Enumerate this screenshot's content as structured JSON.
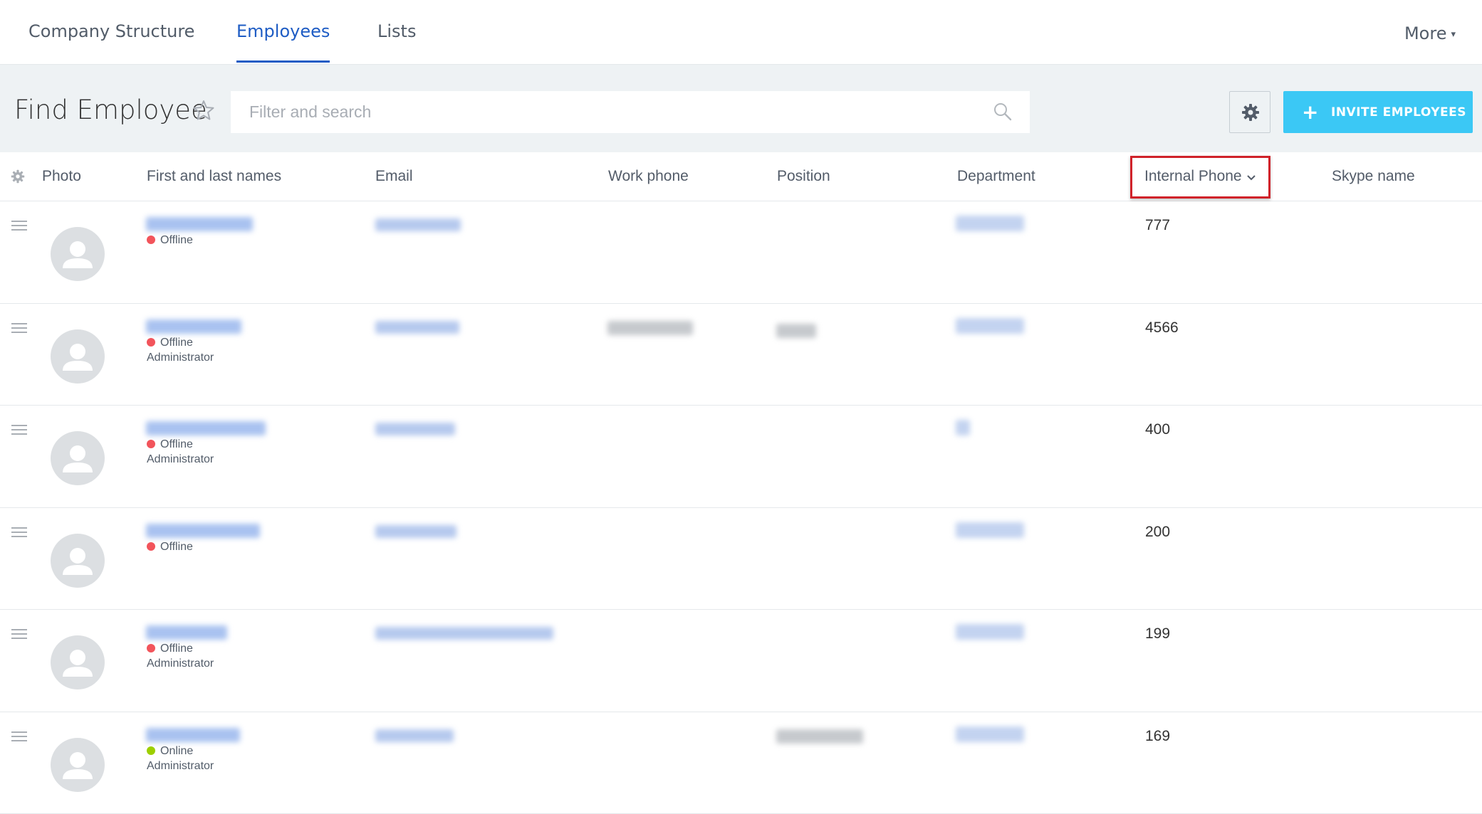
{
  "nav": {
    "tabs": [
      {
        "label": "Company Structure",
        "active": false
      },
      {
        "label": "Employees",
        "active": true
      },
      {
        "label": "Lists",
        "active": false
      }
    ],
    "more_label": "More"
  },
  "toolbar": {
    "title": "Find Employee",
    "search_placeholder": "Filter and search",
    "invite_label": "INVITE EMPLOYEES"
  },
  "grid": {
    "columns": {
      "photo": "Photo",
      "names": "First and last names",
      "email": "Email",
      "work_phone": "Work phone",
      "position": "Position",
      "department": "Department",
      "internal_phone": "Internal Phone",
      "skype": "Skype name"
    },
    "rows": [
      {
        "status": "Offline",
        "role": "",
        "internal_phone": "777"
      },
      {
        "status": "Offline",
        "role": "Administrator",
        "internal_phone": "4566"
      },
      {
        "status": "Offline",
        "role": "Administrator",
        "internal_phone": "400"
      },
      {
        "status": "Offline",
        "role": "",
        "internal_phone": "200"
      },
      {
        "status": "Offline",
        "role": "Administrator",
        "internal_phone": "199"
      },
      {
        "status": "Online",
        "role": "Administrator",
        "internal_phone": "169"
      }
    ]
  },
  "colors": {
    "accent": "#1e5cc4",
    "invite_button": "#3bc8f5",
    "offline_dot": "#f2545b",
    "online_dot": "#9dcf00",
    "highlight_border": "#d0222a"
  },
  "icons": {
    "favorite": "star-icon",
    "search": "search-icon",
    "settings": "gear-icon",
    "invite": "plus-icon",
    "sort": "chevron-down-icon",
    "row_handle": "drag-handle-icon",
    "photo": "user-avatar-icon"
  }
}
